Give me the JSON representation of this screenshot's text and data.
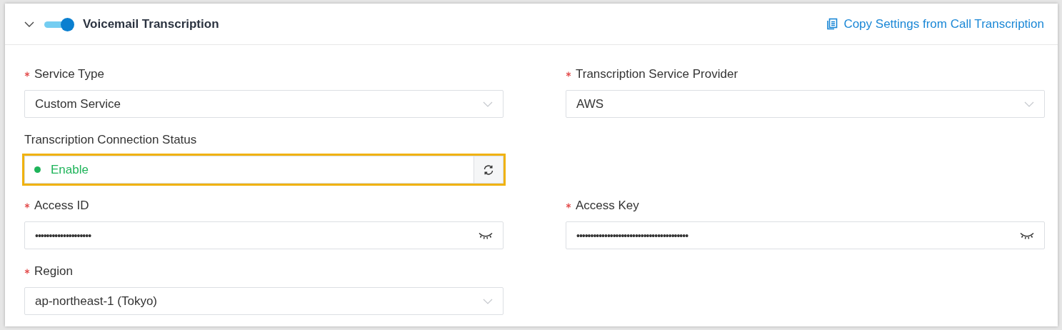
{
  "section": {
    "title": "Voicemail Transcription",
    "expanded": true,
    "enabled": true,
    "copy_link": "Copy Settings from Call Transcription"
  },
  "rows": [
    {
      "fields": [
        {
          "kind": "select",
          "label": "Service Type",
          "required": true,
          "value": "Custom Service"
        },
        {
          "kind": "select",
          "label": "Transcription Service Provider",
          "required": true,
          "value": "AWS"
        }
      ]
    },
    {
      "fields": [
        {
          "kind": "status",
          "label": "Transcription Connection Status",
          "required": false,
          "value": "Enable",
          "color": "#1fb45a",
          "highlighted": true
        }
      ]
    },
    {
      "fields": [
        {
          "kind": "secret",
          "label": "Access ID",
          "required": true,
          "value": "••••••••••••••••••••"
        },
        {
          "kind": "secret",
          "label": "Access Key",
          "required": true,
          "value": "••••••••••••••••••••••••••••••••••••••••"
        }
      ]
    },
    {
      "fields": [
        {
          "kind": "select",
          "label": "Region",
          "required": true,
          "value": "ap-northeast-1 (Tokyo)"
        }
      ]
    }
  ]
}
